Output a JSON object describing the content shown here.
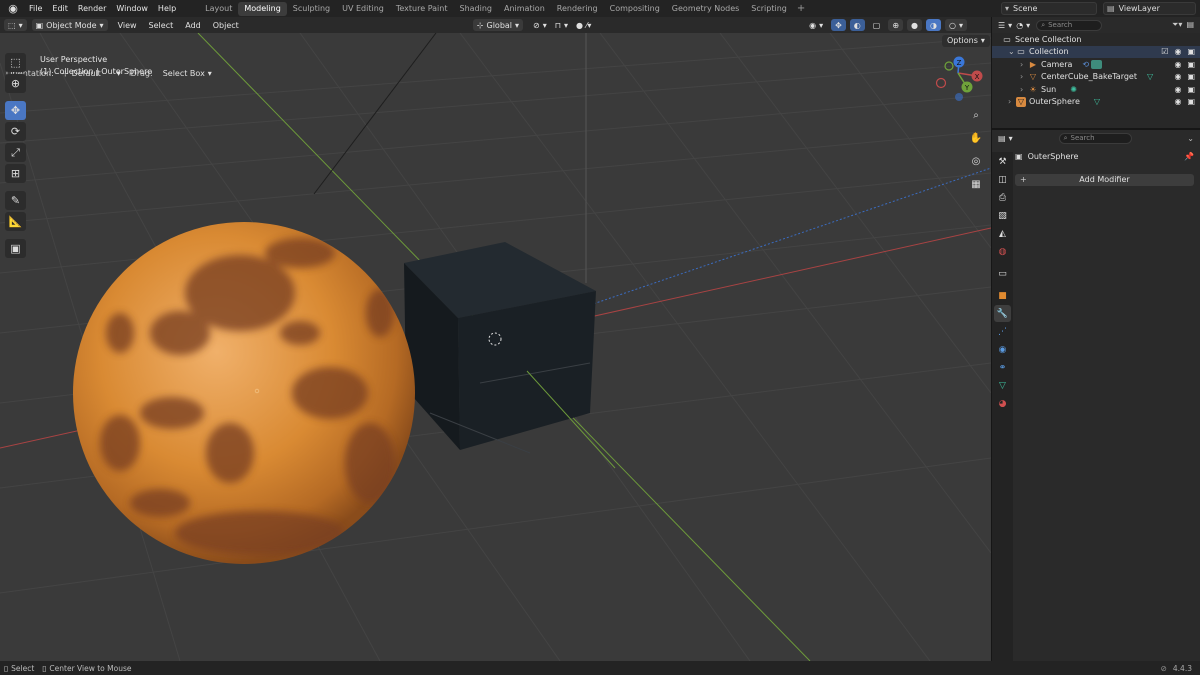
{
  "topbar": {
    "menus": [
      "File",
      "Edit",
      "Render",
      "Window",
      "Help"
    ],
    "workspaces": [
      "Layout",
      "Modeling",
      "Sculpting",
      "UV Editing",
      "Texture Paint",
      "Shading",
      "Animation",
      "Rendering",
      "Compositing",
      "Geometry Nodes",
      "Scripting"
    ],
    "active_workspace": "Modeling",
    "add_workspace": "+",
    "scene": "Scene",
    "view_layer": "ViewLayer"
  },
  "viewport_header": {
    "mode": "Object Mode",
    "menus": [
      "View",
      "Select",
      "Add",
      "Object"
    ],
    "transform_orientation": "Global"
  },
  "tool_settings": {
    "orientation_label": "Orientation:",
    "orientation_value": "Default",
    "drag_label": "Drag:",
    "drag_value": "Select Box",
    "options": "Options"
  },
  "viewport": {
    "perspective": "User Perspective",
    "context": "(1) Collection | OuterSphere",
    "gizmo": {
      "x": "X",
      "y": "Y",
      "z": "Z"
    }
  },
  "toolbar": {
    "tools": [
      "select-box",
      "cursor",
      "move",
      "rotate",
      "scale",
      "transform",
      "annotate",
      "measure",
      "add-cube"
    ],
    "active": "move"
  },
  "outliner": {
    "search_placeholder": "Search",
    "root": "Scene Collection",
    "collection": "Collection",
    "items": [
      {
        "name": "Camera",
        "icon": "camera-icon"
      },
      {
        "name": "CenterCube_BakeTarget",
        "icon": "mesh-icon"
      },
      {
        "name": "Sun",
        "icon": "light-icon"
      }
    ],
    "outer": "OuterSphere"
  },
  "properties": {
    "search_placeholder": "Search",
    "object_name": "OuterSphere",
    "add_modifier": "Add Modifier"
  },
  "statusbar": {
    "select": "Select",
    "center_view": "Center View to Mouse",
    "version": "4.4.3"
  },
  "colors": {
    "accent": "#4a77c3",
    "axis_x": "#c04b4b",
    "axis_y": "#6fa33a",
    "axis_z": "#3a77d8",
    "sphere": "#d9892f",
    "cube": "#1b2126"
  }
}
